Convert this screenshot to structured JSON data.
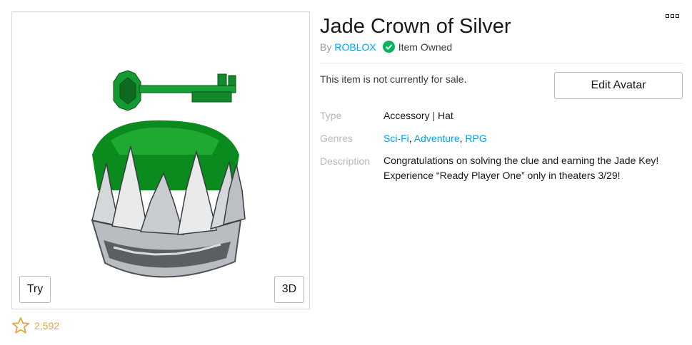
{
  "item": {
    "title": "Jade Crown of Silver",
    "by_prefix": "By",
    "creator": "ROBLOX",
    "owned_label": "Item Owned",
    "sale_status": "This item is not currently for sale.",
    "edit_avatar_label": "Edit Avatar"
  },
  "thumbnail": {
    "try_label": "Try",
    "view3d_label": "3D",
    "image": "jade-crown-of-silver"
  },
  "favorites": {
    "count": "2,592",
    "icon": "star-icon"
  },
  "details": {
    "type_label": "Type",
    "type_primary": "Accessory",
    "type_separator": "|",
    "type_secondary": "Hat",
    "genres_label": "Genres",
    "genres": [
      "Sci-Fi",
      "Adventure",
      "RPG"
    ],
    "genre_separator": ",",
    "description_label": "Description",
    "description_line1": "Congratulations on solving the clue and earning the Jade Key!",
    "description_line2": "Experience “Ready Player One” only in theaters 3/29!"
  },
  "colors": {
    "link": "#00a2ff",
    "owned_check": "#02b757",
    "favorite": "#e2a53f",
    "jade": "#0a8a1e"
  }
}
